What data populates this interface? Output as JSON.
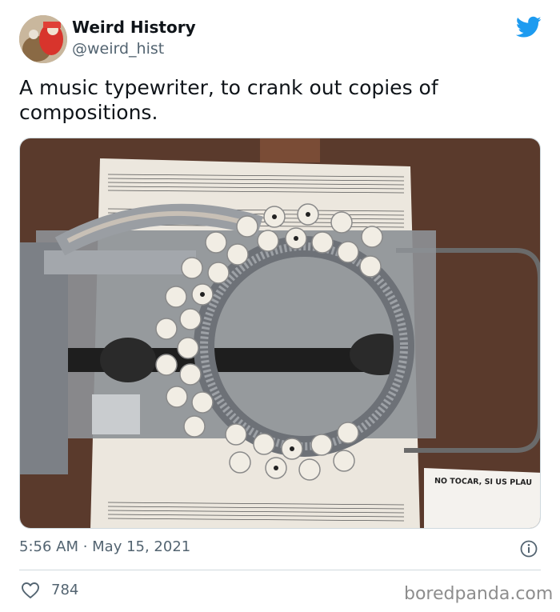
{
  "author": {
    "display_name": "Weird History",
    "handle": "@weird_hist"
  },
  "tweet": {
    "text": "A music typewriter, to crank out copies of compositions."
  },
  "media": {
    "sign_text": "NO TOCAR, SI US PLAU"
  },
  "footer": {
    "timestamp": "5:56 AM · May 15, 2021",
    "like_count": "784"
  },
  "watermark": "boredpanda.com",
  "colors": {
    "twitter_blue": "#1d9bf0",
    "secondary_text": "#536471"
  }
}
